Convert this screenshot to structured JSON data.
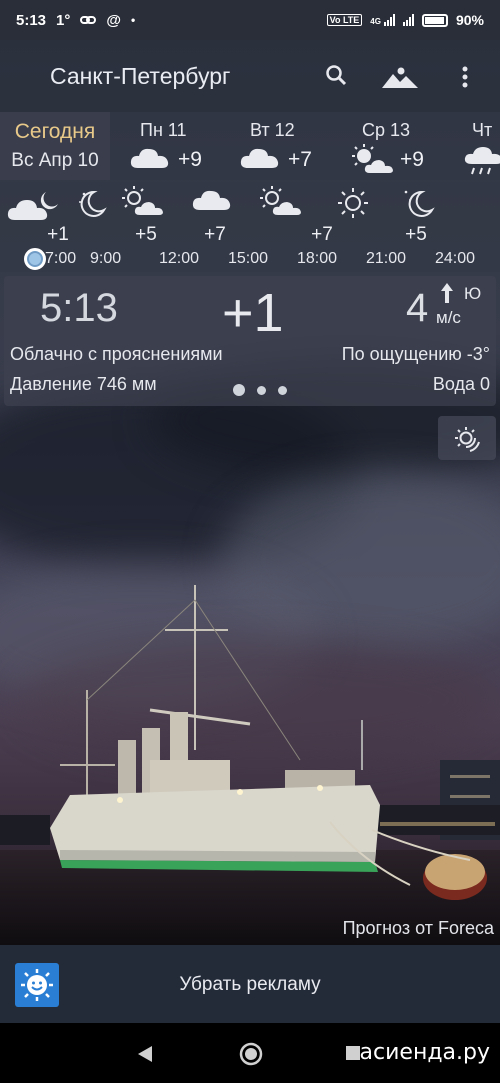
{
  "status_bar": {
    "time": "5:13",
    "temp_badge": "1°",
    "battery": "90%",
    "volte": "Vo LTE",
    "net": "4G"
  },
  "app_bar": {
    "city": "Санкт-Петербург",
    "icons": [
      "search-icon",
      "landscape-icon",
      "more-vert-icon"
    ]
  },
  "days": [
    {
      "label": "Сегодня",
      "date": "Вс Апр 10",
      "selected": true
    },
    {
      "label": "Пн 11",
      "temp": "+9",
      "icon": "cloud"
    },
    {
      "label": "Вт 12",
      "temp": "+7",
      "icon": "cloud"
    },
    {
      "label": "Ср 13",
      "temp": "+9",
      "icon": "partly-sunny"
    },
    {
      "label": "Чт",
      "temp": "",
      "icon": "rain"
    }
  ],
  "hourly": [
    {
      "temp": "+1",
      "time": "7:00"
    },
    {
      "temp": "+5",
      "time": "9:00"
    },
    {
      "temp": "+7",
      "time": "12:00"
    },
    {
      "temp": "+7",
      "time": "15:00"
    },
    {
      "temp": "+5",
      "time": "18:00"
    },
    {
      "temp": "",
      "time": "21:00"
    },
    {
      "temp": "",
      "time": "24:00"
    }
  ],
  "current": {
    "time": "5:13",
    "temp": "+1",
    "wind_speed": "4",
    "wind_dir": "Ю",
    "wind_unit": "м/с",
    "description": "Облачно с прояснениями",
    "feels_like": "По ощущению -3°",
    "pressure": "Давление 746 мм",
    "water": "Вода 0"
  },
  "credit": "Прогноз от Foreca",
  "ad": {
    "label": "Убрать рекламу"
  },
  "watermark": "асиенда.ру"
}
